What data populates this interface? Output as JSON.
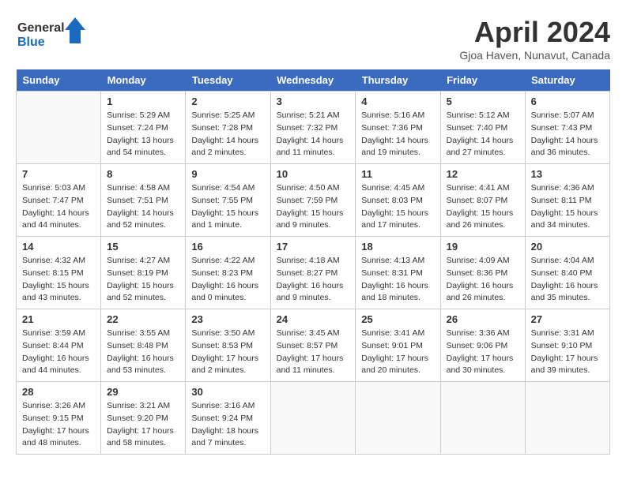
{
  "logo": {
    "line1": "General",
    "line2": "Blue"
  },
  "title": "April 2024",
  "subtitle": "Gjoa Haven, Nunavut, Canada",
  "weekdays": [
    "Sunday",
    "Monday",
    "Tuesday",
    "Wednesday",
    "Thursday",
    "Friday",
    "Saturday"
  ],
  "weeks": [
    [
      {
        "day": "",
        "sunrise": "",
        "sunset": "",
        "daylight": ""
      },
      {
        "day": "1",
        "sunrise": "5:29 AM",
        "sunset": "7:24 PM",
        "daylight": "13 hours and 54 minutes."
      },
      {
        "day": "2",
        "sunrise": "5:25 AM",
        "sunset": "7:28 PM",
        "daylight": "14 hours and 2 minutes."
      },
      {
        "day": "3",
        "sunrise": "5:21 AM",
        "sunset": "7:32 PM",
        "daylight": "14 hours and 11 minutes."
      },
      {
        "day": "4",
        "sunrise": "5:16 AM",
        "sunset": "7:36 PM",
        "daylight": "14 hours and 19 minutes."
      },
      {
        "day": "5",
        "sunrise": "5:12 AM",
        "sunset": "7:40 PM",
        "daylight": "14 hours and 27 minutes."
      },
      {
        "day": "6",
        "sunrise": "5:07 AM",
        "sunset": "7:43 PM",
        "daylight": "14 hours and 36 minutes."
      }
    ],
    [
      {
        "day": "7",
        "sunrise": "5:03 AM",
        "sunset": "7:47 PM",
        "daylight": "14 hours and 44 minutes."
      },
      {
        "day": "8",
        "sunrise": "4:58 AM",
        "sunset": "7:51 PM",
        "daylight": "14 hours and 52 minutes."
      },
      {
        "day": "9",
        "sunrise": "4:54 AM",
        "sunset": "7:55 PM",
        "daylight": "15 hours and 1 minute."
      },
      {
        "day": "10",
        "sunrise": "4:50 AM",
        "sunset": "7:59 PM",
        "daylight": "15 hours and 9 minutes."
      },
      {
        "day": "11",
        "sunrise": "4:45 AM",
        "sunset": "8:03 PM",
        "daylight": "15 hours and 17 minutes."
      },
      {
        "day": "12",
        "sunrise": "4:41 AM",
        "sunset": "8:07 PM",
        "daylight": "15 hours and 26 minutes."
      },
      {
        "day": "13",
        "sunrise": "4:36 AM",
        "sunset": "8:11 PM",
        "daylight": "15 hours and 34 minutes."
      }
    ],
    [
      {
        "day": "14",
        "sunrise": "4:32 AM",
        "sunset": "8:15 PM",
        "daylight": "15 hours and 43 minutes."
      },
      {
        "day": "15",
        "sunrise": "4:27 AM",
        "sunset": "8:19 PM",
        "daylight": "15 hours and 52 minutes."
      },
      {
        "day": "16",
        "sunrise": "4:22 AM",
        "sunset": "8:23 PM",
        "daylight": "16 hours and 0 minutes."
      },
      {
        "day": "17",
        "sunrise": "4:18 AM",
        "sunset": "8:27 PM",
        "daylight": "16 hours and 9 minutes."
      },
      {
        "day": "18",
        "sunrise": "4:13 AM",
        "sunset": "8:31 PM",
        "daylight": "16 hours and 18 minutes."
      },
      {
        "day": "19",
        "sunrise": "4:09 AM",
        "sunset": "8:36 PM",
        "daylight": "16 hours and 26 minutes."
      },
      {
        "day": "20",
        "sunrise": "4:04 AM",
        "sunset": "8:40 PM",
        "daylight": "16 hours and 35 minutes."
      }
    ],
    [
      {
        "day": "21",
        "sunrise": "3:59 AM",
        "sunset": "8:44 PM",
        "daylight": "16 hours and 44 minutes."
      },
      {
        "day": "22",
        "sunrise": "3:55 AM",
        "sunset": "8:48 PM",
        "daylight": "16 hours and 53 minutes."
      },
      {
        "day": "23",
        "sunrise": "3:50 AM",
        "sunset": "8:53 PM",
        "daylight": "17 hours and 2 minutes."
      },
      {
        "day": "24",
        "sunrise": "3:45 AM",
        "sunset": "8:57 PM",
        "daylight": "17 hours and 11 minutes."
      },
      {
        "day": "25",
        "sunrise": "3:41 AM",
        "sunset": "9:01 PM",
        "daylight": "17 hours and 20 minutes."
      },
      {
        "day": "26",
        "sunrise": "3:36 AM",
        "sunset": "9:06 PM",
        "daylight": "17 hours and 30 minutes."
      },
      {
        "day": "27",
        "sunrise": "3:31 AM",
        "sunset": "9:10 PM",
        "daylight": "17 hours and 39 minutes."
      }
    ],
    [
      {
        "day": "28",
        "sunrise": "3:26 AM",
        "sunset": "9:15 PM",
        "daylight": "17 hours and 48 minutes."
      },
      {
        "day": "29",
        "sunrise": "3:21 AM",
        "sunset": "9:20 PM",
        "daylight": "17 hours and 58 minutes."
      },
      {
        "day": "30",
        "sunrise": "3:16 AM",
        "sunset": "9:24 PM",
        "daylight": "18 hours and 7 minutes."
      },
      {
        "day": "",
        "sunrise": "",
        "sunset": "",
        "daylight": ""
      },
      {
        "day": "",
        "sunrise": "",
        "sunset": "",
        "daylight": ""
      },
      {
        "day": "",
        "sunrise": "",
        "sunset": "",
        "daylight": ""
      },
      {
        "day": "",
        "sunrise": "",
        "sunset": "",
        "daylight": ""
      }
    ]
  ]
}
